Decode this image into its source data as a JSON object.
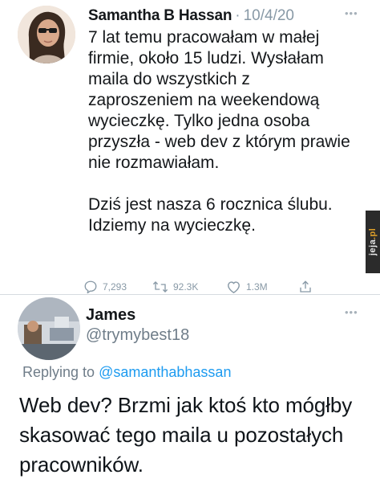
{
  "tweet": {
    "author_name": "Samantha B Hassan",
    "separator": "·",
    "date": "10/4/20",
    "paragraphs": [
      "7 lat temu pracowałam w małej firmie, około 15 ludzi. Wysłałam maila do wszystkich z zaproszeniem na weekendową wycieczkę. Tylko jedna osoba przyszła - web dev z którym prawie nie rozmawiałam.",
      "Dziś jest nasza 6 rocznica ślubu. Idziemy na wycieczkę."
    ],
    "actions": {
      "reply_icon": "reply-icon",
      "reply_count": "7,293",
      "retweet_icon": "retweet-icon",
      "retweet_count": "92.3K",
      "like_icon": "heart-icon",
      "like_count": "1.3M",
      "share_icon": "share-icon"
    },
    "more_icon": "more-dots-icon"
  },
  "watermark": {
    "text_main": "jeja",
    "text_suffix": ".pl"
  },
  "reply": {
    "author_name": "James",
    "handle": "@trymybest18",
    "replying_to_label": "Replying to",
    "replying_to_handle": "@samanthabhassan",
    "text": "Web dev? Brzmi jak ktoś kto mógłby skasować tego maila u pozostałych pracowników.",
    "more_icon": "more-dots-icon"
  },
  "colors": {
    "muted": "#8899a6",
    "text": "#14171a",
    "link": "#1d9bf0",
    "divider": "#d6dbe0"
  }
}
